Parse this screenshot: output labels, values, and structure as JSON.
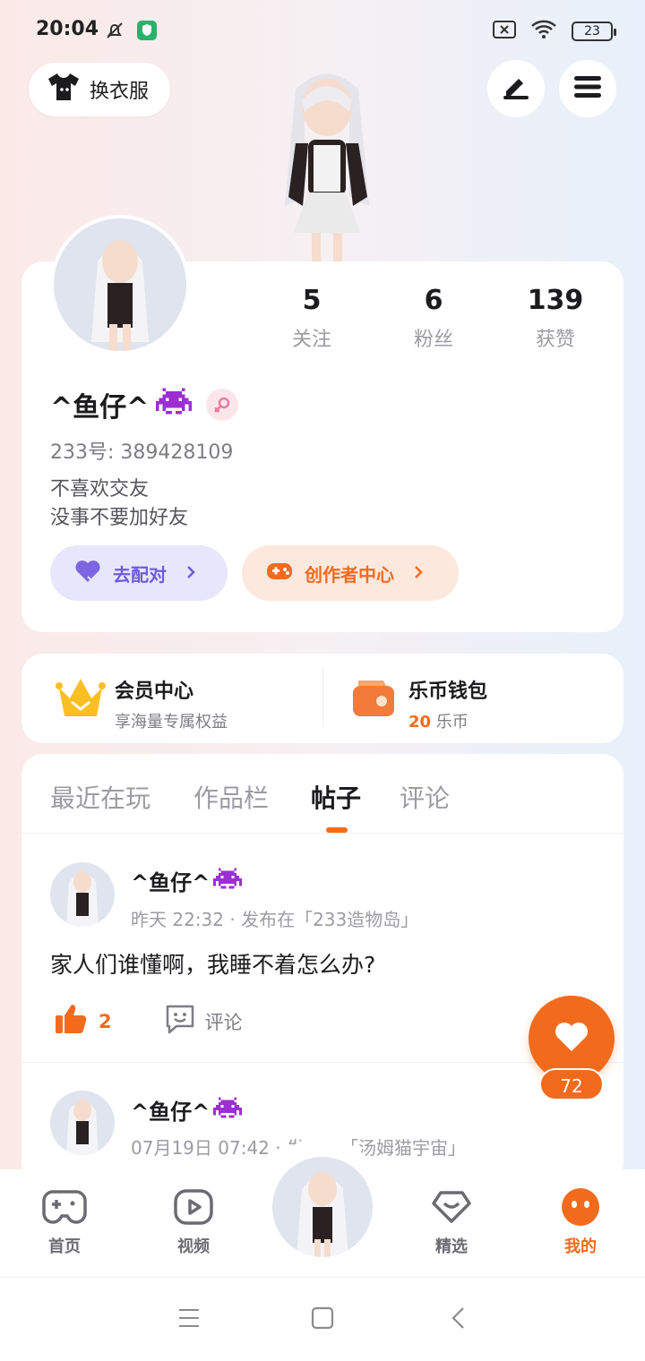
{
  "status_bar": {
    "time": "20:04",
    "battery": "23",
    "icons": [
      "bell-off-icon",
      "shield-app-icon",
      "sim-off-icon",
      "wifi-icon",
      "battery-icon"
    ]
  },
  "top_bar": {
    "dress_label": "换衣服",
    "icons": [
      "tshirt-icon",
      "edit-icon",
      "menu-icon"
    ]
  },
  "profile": {
    "stats": [
      {
        "value": "5",
        "label": "关注"
      },
      {
        "value": "6",
        "label": "粉丝"
      },
      {
        "value": "139",
        "label": "获赞"
      }
    ],
    "username": "^鱼仔^",
    "uid": "233号: 389428109",
    "bio_line1": "不喜欢交友",
    "bio_line2": "没事不要加好友",
    "match_label": "去配对",
    "creator_label": "创作者中心"
  },
  "member": {
    "vip_title": "会员中心",
    "vip_sub": "享海量专属权益",
    "wallet_title": "乐币钱包",
    "wallet_amount": "20",
    "wallet_unit": "乐币"
  },
  "tabs": [
    "最近在玩",
    "作品栏",
    "帖子",
    "评论"
  ],
  "active_tab": "帖子",
  "posts": [
    {
      "author": "^鱼仔^",
      "meta": "昨天 22:32 · 发布在「233造物岛」",
      "text": "家人们谁懂啊，我睡不着怎么办?",
      "likes": "2",
      "comment_label": "评论"
    },
    {
      "author": "^鱼仔^",
      "meta": "07月19日 07:42 · 发布在「汤姆猫宇宙」"
    }
  ],
  "fab": {
    "count": "72"
  },
  "nav": {
    "items": [
      {
        "label": "首页"
      },
      {
        "label": "视频"
      },
      {
        "label": "精选"
      },
      {
        "label": "我的"
      }
    ],
    "active": "我的"
  },
  "colors": {
    "accent": "#f26b1d",
    "purple": "#6f5bd9",
    "card": "#ffffff"
  }
}
